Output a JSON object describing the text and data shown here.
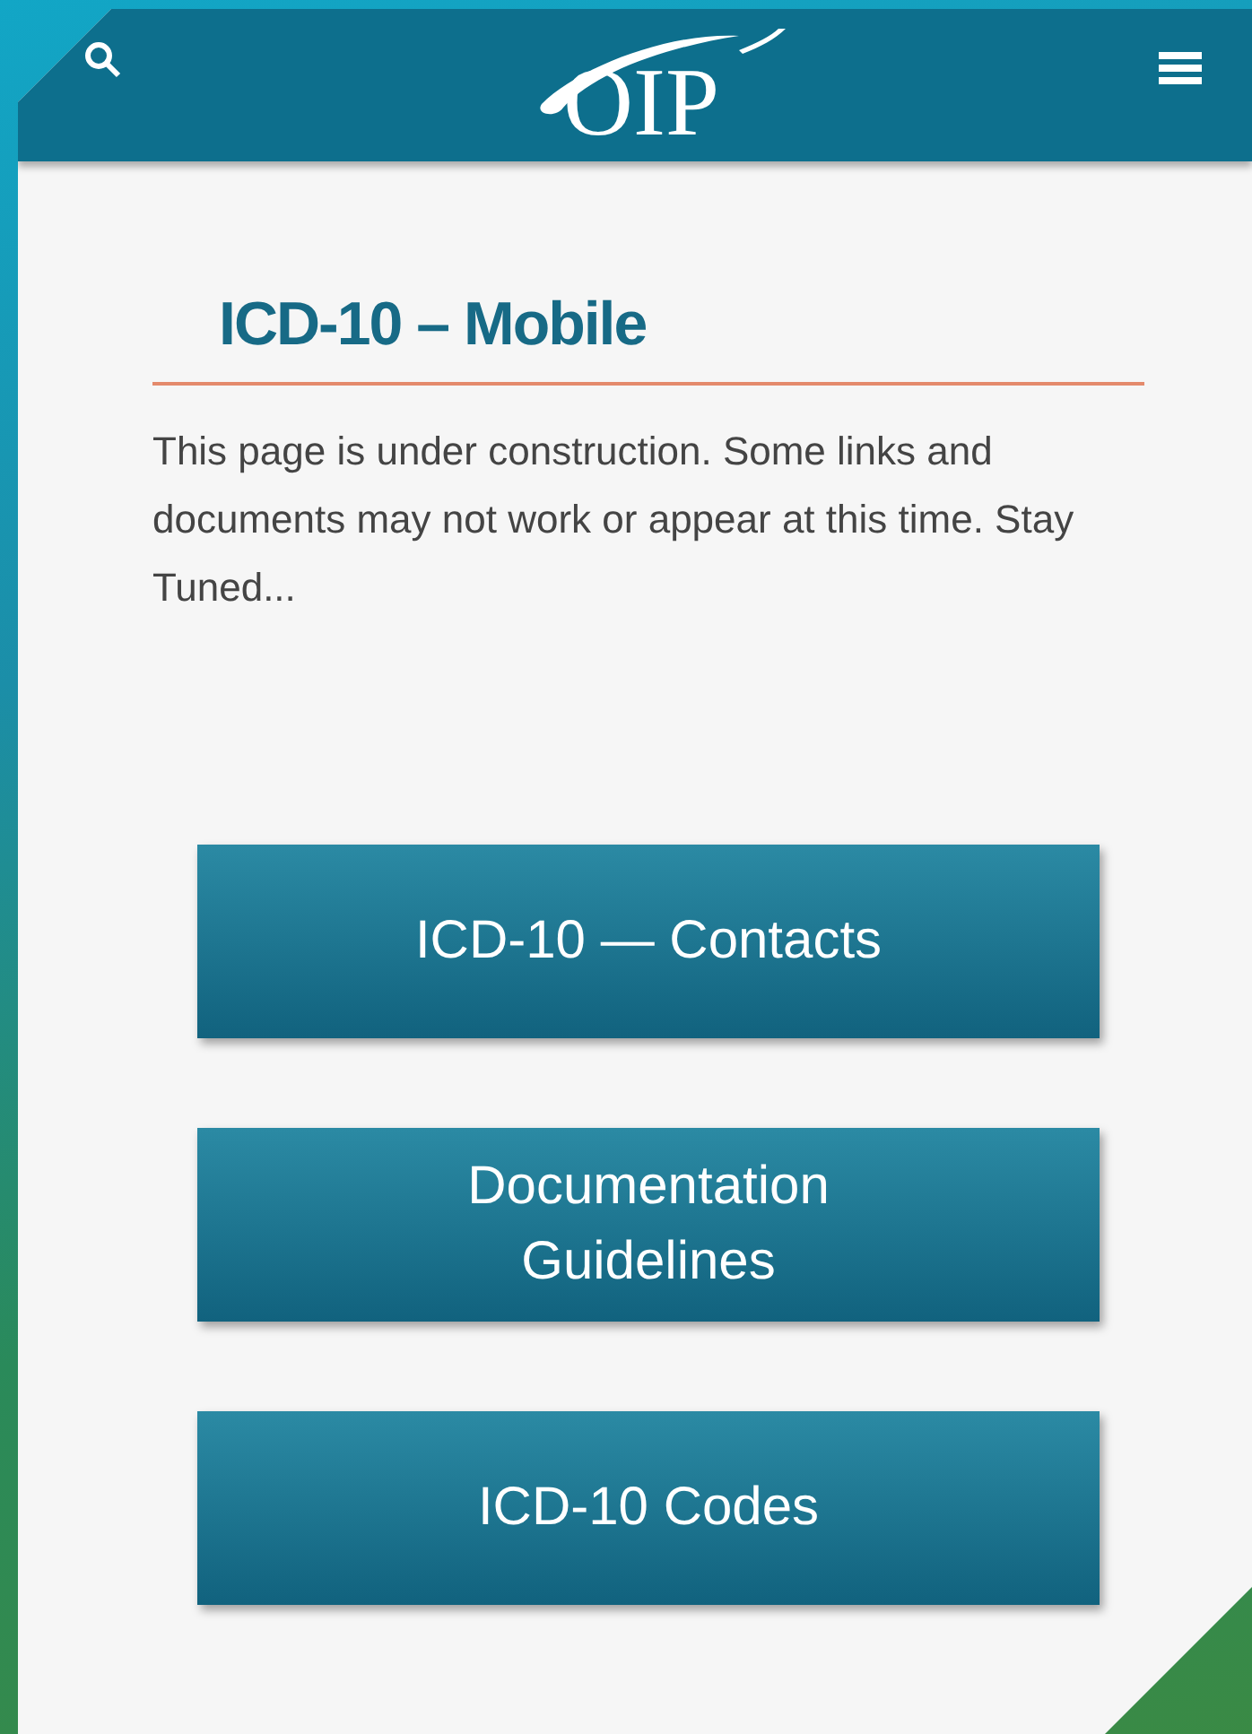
{
  "header": {
    "logo": "OIP"
  },
  "title": "ICD-10 – Mobile",
  "notice": "This page is under construction. Some links and documents may not work or appear at this time. Stay Tuned...",
  "buttons": [
    {
      "label": "ICD-10 — Contacts"
    },
    {
      "label": "Documentation Guidelines"
    },
    {
      "label": "ICD-10 Codes"
    }
  ]
}
